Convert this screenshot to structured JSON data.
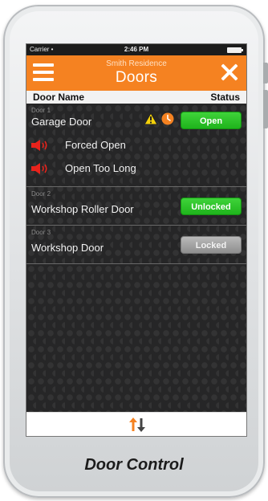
{
  "status_bar": {
    "carrier": "Carrier •",
    "time": "2:46 PM"
  },
  "header": {
    "subtitle": "Smith Residence",
    "title": "Doors"
  },
  "columns": {
    "name": "Door Name",
    "status": "Status"
  },
  "doors": [
    {
      "number": "Door 1",
      "name": "Garage Door",
      "status": "Open",
      "status_color": "#22b520",
      "alerts": [
        "Forced Open",
        "Open Too Long"
      ]
    },
    {
      "number": "Door 2",
      "name": "Workshop Roller Door",
      "status": "Unlocked",
      "status_color": "#22b520"
    },
    {
      "number": "Door 3",
      "name": "Workshop Door",
      "status": "Locked",
      "status_color": "#a0a0a0"
    }
  ],
  "icons": {
    "menu": "hamburger-icon",
    "close": "close-icon",
    "warning": "warning-icon",
    "clock": "clock-icon",
    "alarm": "speaker-icon",
    "sort": "sort-arrows-icon"
  },
  "colors": {
    "accent": "#f58221",
    "ok": "#22b520",
    "alarm": "#e8231c"
  },
  "caption": "Door Control"
}
